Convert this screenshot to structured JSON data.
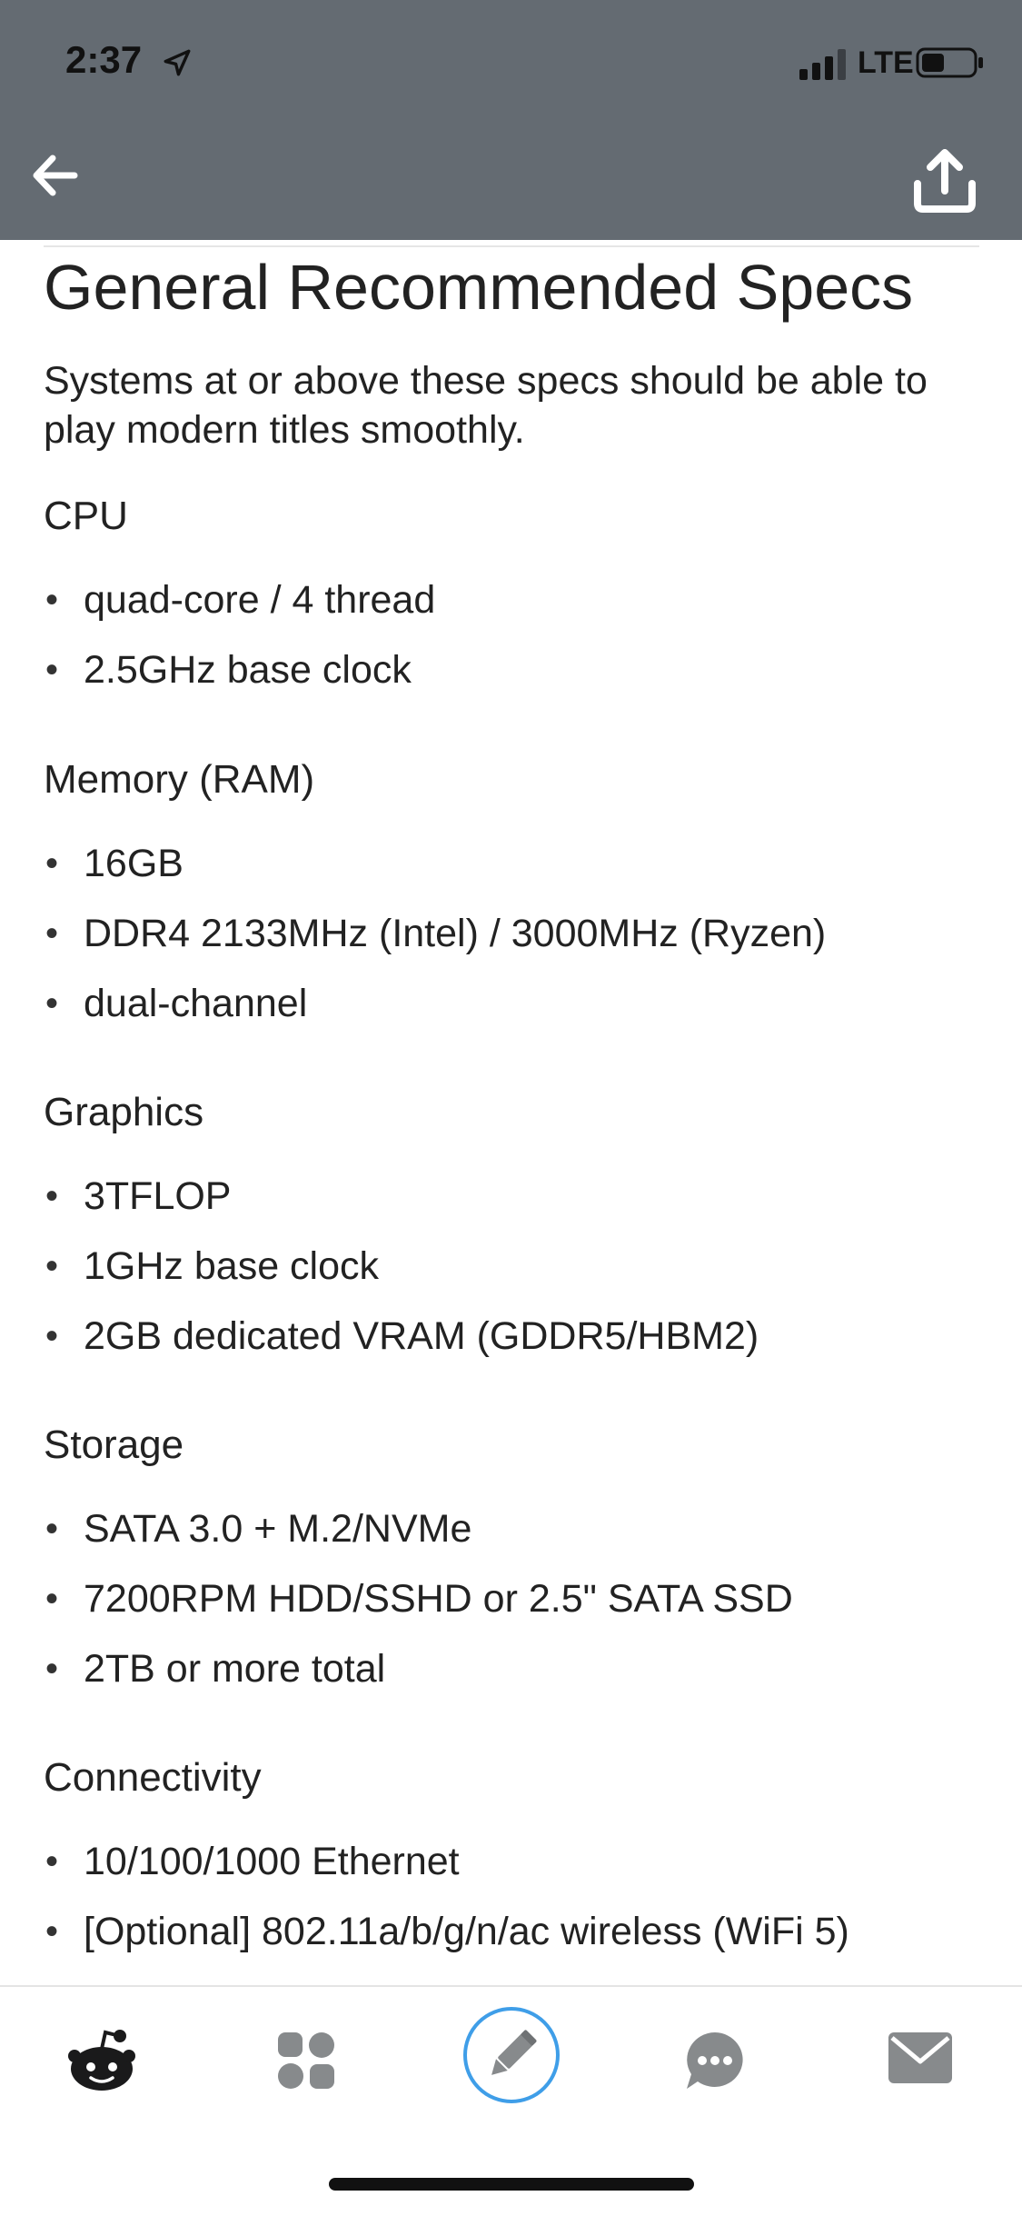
{
  "status_bar": {
    "time": "2:37",
    "network": "LTE"
  },
  "header": {
    "back_icon": "arrow-left-icon",
    "share_icon": "share-upload-icon"
  },
  "article": {
    "title": "General Recommended Specs",
    "intro": "Systems at or above these specs should be able to play modern titles smoothly.",
    "sections": [
      {
        "heading": "CPU",
        "items": [
          "quad-core / 4 thread",
          "2.5GHz base clock"
        ]
      },
      {
        "heading": "Memory (RAM)",
        "items": [
          "16GB",
          "DDR4 2133MHz (Intel) / 3000MHz (Ryzen)",
          "dual-channel"
        ]
      },
      {
        "heading": "Graphics",
        "items": [
          "3TFLOP",
          "1GHz base clock",
          "2GB dedicated VRAM (GDDR5/HBM2)"
        ]
      },
      {
        "heading": "Storage",
        "items": [
          "SATA 3.0 + M.2/NVMe",
          "7200RPM HDD/SSHD or 2.5\" SATA SSD",
          "2TB or more total"
        ]
      },
      {
        "heading": "Connectivity",
        "items": [
          "10/100/1000 Ethernet",
          "[Optional] 802.11a/b/g/n/ac wireless (WiFi 5)"
        ]
      }
    ]
  },
  "tabs": [
    {
      "name": "home",
      "icon": "reddit-alien-icon"
    },
    {
      "name": "communities",
      "icon": "grid-icon"
    },
    {
      "name": "post",
      "icon": "pencil-icon"
    },
    {
      "name": "chat",
      "icon": "chat-bubble-icon"
    },
    {
      "name": "inbox",
      "icon": "envelope-icon"
    }
  ],
  "colors": {
    "header_bg": "#646b72",
    "accent": "#3f9ee8",
    "tab_icon": "#878a8c",
    "tab_icon_active": "#1a1a1b"
  }
}
